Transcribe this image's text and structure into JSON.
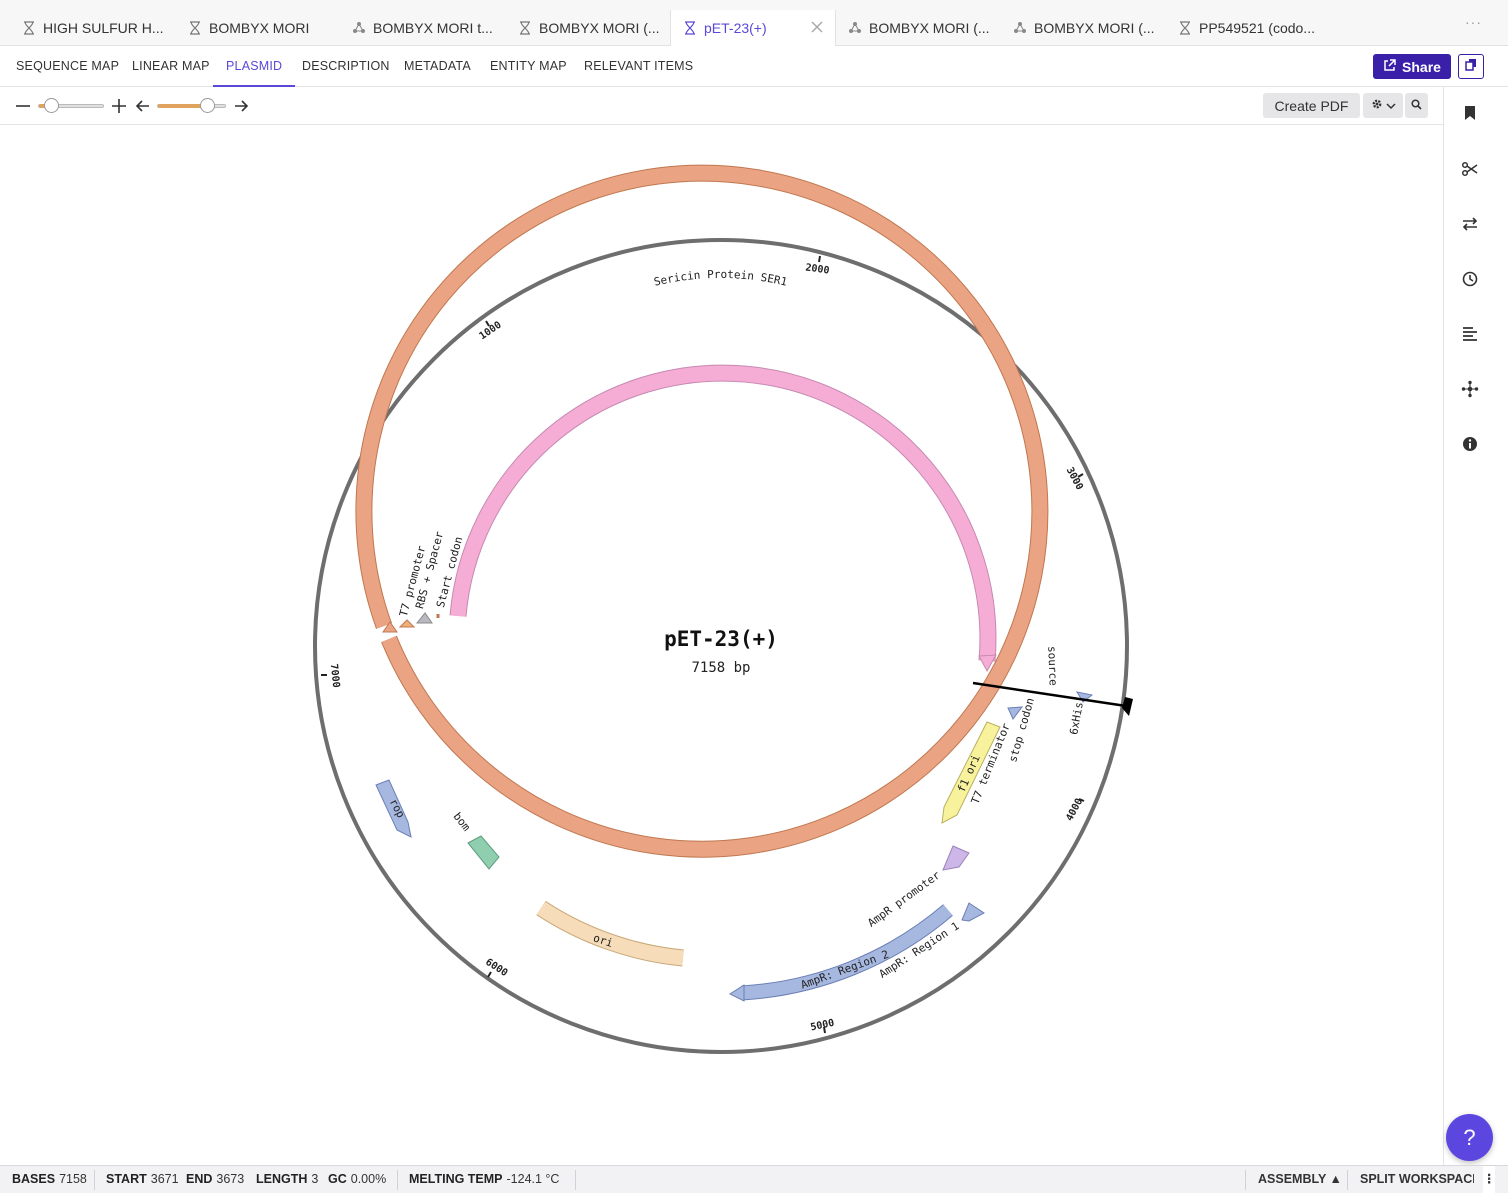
{
  "doc_tabs": [
    {
      "label": "HIGH SULFUR H...",
      "icon": "sequence-icon",
      "active": false
    },
    {
      "label": "BOMBYX MORI",
      "icon": "sequence-icon",
      "active": false
    },
    {
      "label": "BOMBYX MORI t...",
      "icon": "protein-icon",
      "active": false
    },
    {
      "label": "BOMBYX MORI (...",
      "icon": "sequence-icon",
      "active": false
    },
    {
      "label": "pET-23(+)",
      "icon": "sequence-icon",
      "active": true
    },
    {
      "label": "BOMBYX MORI (...",
      "icon": "protein-icon",
      "active": false
    },
    {
      "label": "BOMBYX MORI (...",
      "icon": "protein-icon",
      "active": false
    },
    {
      "label": "PP549521 (codo...",
      "icon": "sequence-icon",
      "active": false
    }
  ],
  "tabs_more": "···",
  "view_tabs": [
    {
      "label": "SEQUENCE MAP",
      "active": false
    },
    {
      "label": "LINEAR MAP",
      "active": false
    },
    {
      "label": "PLASMID",
      "active": true
    },
    {
      "label": "DESCRIPTION",
      "active": false
    },
    {
      "label": "METADATA",
      "active": false
    },
    {
      "label": "ENTITY MAP",
      "active": false
    },
    {
      "label": "RELEVANT ITEMS",
      "active": false
    }
  ],
  "share_label": "Share",
  "toolbar": {
    "create_pdf_label": "Create PDF",
    "zoom_level": 0.2,
    "rotation_level": 0.75
  },
  "plasmid": {
    "name": "pET-23(+)",
    "length_label": "7158 bp",
    "total_bp": 7158,
    "ticks": [
      "1000",
      "2000",
      "3000",
      "4000",
      "5000",
      "6000",
      "7000"
    ],
    "features": [
      {
        "label": "source",
        "color": "#eaa383"
      },
      {
        "label": "Sericin Protein SER1",
        "color": "#f5acd5"
      },
      {
        "label": "T7 promoter",
        "color": "#f0b07a"
      },
      {
        "label": "RBS + Spacer",
        "color": "#b9b9c2"
      },
      {
        "label": "Start codon",
        "color": "#eaa383"
      },
      {
        "label": "6xHis",
        "color": "#a7b8e0"
      },
      {
        "label": "stop codon",
        "color": "#a7b8e0"
      },
      {
        "label": "T7 terminator",
        "color": "#a7b8e0"
      },
      {
        "label": "f1 ori",
        "color": "#f8f29c"
      },
      {
        "label": "AmpR promoter",
        "color": "#cdb7e8"
      },
      {
        "label": "AmpR: Region 1",
        "color": "#a7b8e0"
      },
      {
        "label": "AmpR: Region 2",
        "color": "#a7b8e0"
      },
      {
        "label": "ori",
        "color": "#f6dcb8"
      },
      {
        "label": "bom",
        "color": "#8fcfb0"
      },
      {
        "label": "rop",
        "color": "#a7b8e0"
      }
    ]
  },
  "status": {
    "bases_label": "BASES",
    "bases_value": "7158",
    "start_label": "START",
    "start_value": "3671",
    "end_label": "END",
    "end_value": "3673",
    "length_label": "LENGTH",
    "length_value": "3",
    "gc_label": "GC",
    "gc_value": "0.00%",
    "melting_label": "MELTING TEMP",
    "melting_value": "-124.1 °C",
    "assembly_label": "ASSEMBLY ▲",
    "split_label": "SPLIT WORKSPACE"
  },
  "help_label": "?"
}
